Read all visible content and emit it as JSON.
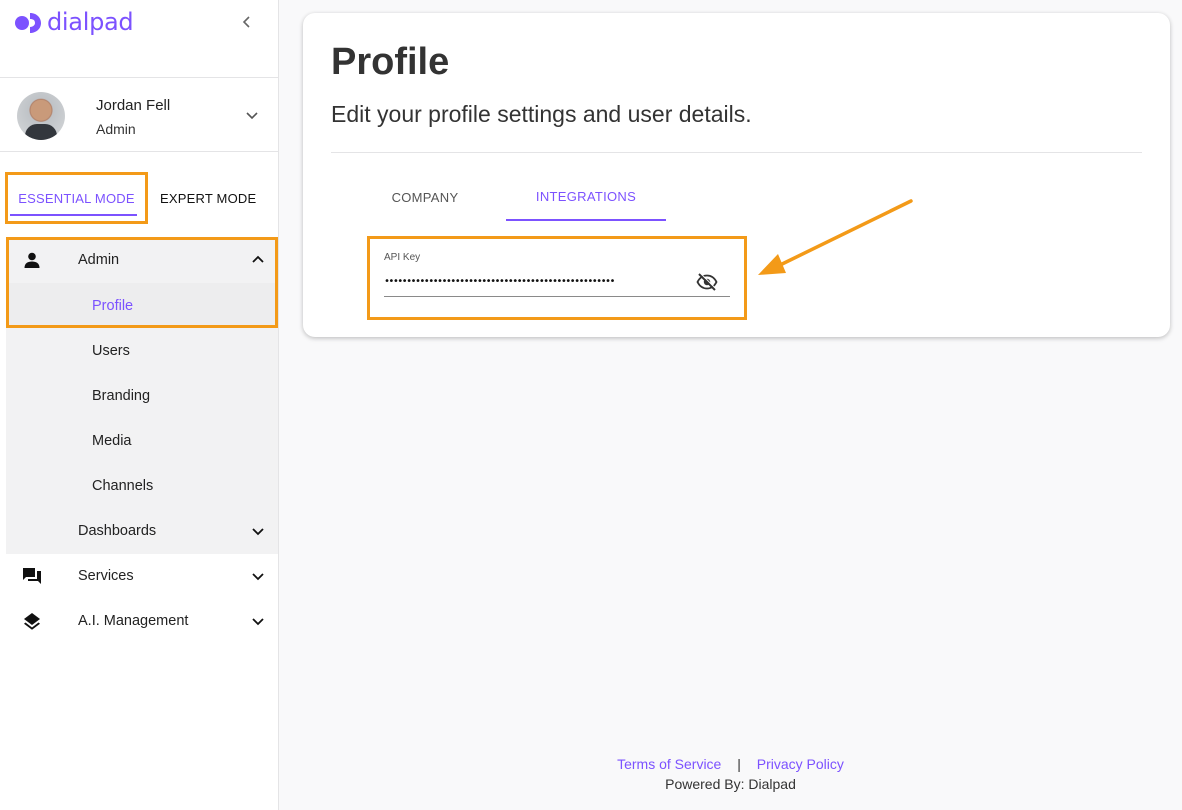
{
  "brand": {
    "name": "dialpad",
    "accent": "#7c52ff",
    "highlight": "#f39a18"
  },
  "user": {
    "name": "Jordan Fell",
    "role": "Admin"
  },
  "modes": {
    "essential": "ESSENTIAL MODE",
    "expert": "EXPERT MODE",
    "active": "essential"
  },
  "nav": {
    "admin": "Admin",
    "profile": "Profile",
    "users": "Users",
    "branding": "Branding",
    "media": "Media",
    "channels": "Channels",
    "dashboards": "Dashboards",
    "services": "Services",
    "ai_management": "A.I. Management"
  },
  "main": {
    "title": "Profile",
    "subtitle": "Edit your profile settings and user details.",
    "tabs": {
      "company": "COMPANY",
      "integrations": "INTEGRATIONS",
      "active": "integrations"
    },
    "api_key": {
      "label": "API Key",
      "value": "••••••••••••••••••••••••••••••••••••••••••••••••••••"
    }
  },
  "footer": {
    "terms": "Terms of Service",
    "separator": "|",
    "privacy": "Privacy Policy",
    "powered_by": "Powered By: Dialpad"
  }
}
